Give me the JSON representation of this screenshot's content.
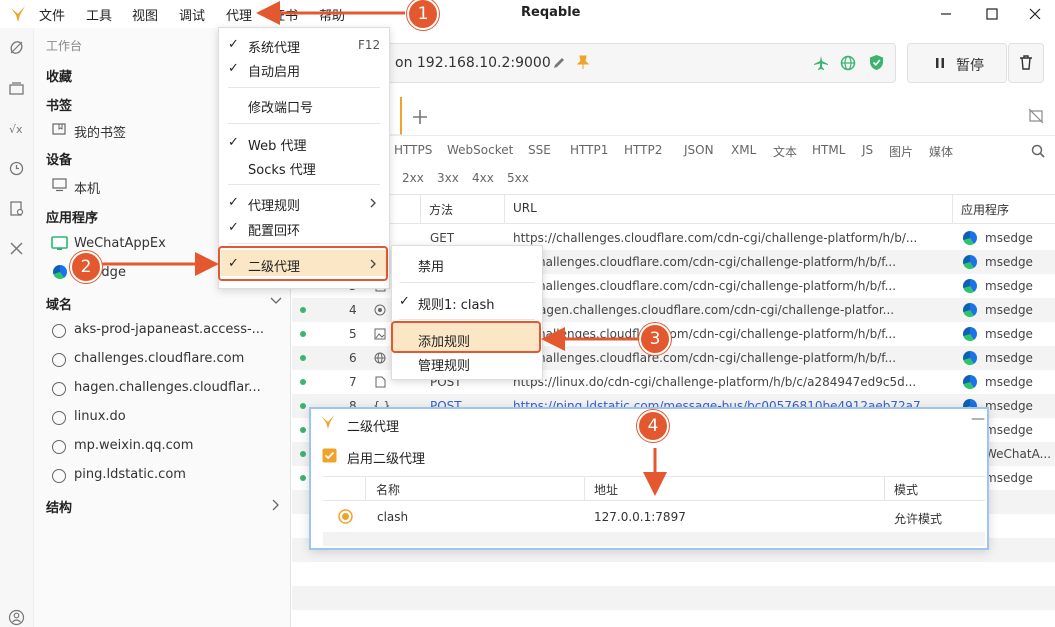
{
  "app": {
    "title": "Reqable"
  },
  "menubar": [
    "文件",
    "工具",
    "视图",
    "调试",
    "代理",
    "证书",
    "帮助"
  ],
  "sidebar": {
    "workspace": "工作台",
    "favorites": "收藏",
    "bookmarks": "书签",
    "my_bookmarks": "我的书签",
    "devices": "设备",
    "this_machine": "本机",
    "apps": "应用程序",
    "app_items": [
      "WeChatAppEx",
      "msedge"
    ],
    "domains": "域名",
    "domain_items": [
      "aks-prod-japaneast.access-...",
      "challenges.cloudflare.com",
      "hagen.challenges.cloudflar...",
      "linux.do",
      "mp.weixin.qq.com",
      "ping.ldstatic.com"
    ],
    "structure": "结构"
  },
  "toolbar": {
    "address": "on 192.168.10.2:9000",
    "pause_label": "暂停"
  },
  "filters": {
    "protocols": [
      "HTTPS",
      "WebSocket",
      "SSE",
      "HTTP1",
      "HTTP2",
      "JSON",
      "XML",
      "文本",
      "HTML",
      "JS",
      "图片",
      "媒体"
    ],
    "status": [
      "2xx",
      "3xx",
      "4xx",
      "5xx"
    ]
  },
  "table": {
    "headers": {
      "method": "方法",
      "url": "URL",
      "app": "应用程序"
    },
    "rows": [
      {
        "id": "",
        "method": "GET",
        "url": "https://challenges.cloudflare.com/cdn-cgi/challenge-platform/h/b/...",
        "app": "msedge"
      },
      {
        "id": "",
        "method": "",
        "url": "s://challenges.cloudflare.com/cdn-cgi/challenge-platform/h/b/f...",
        "app": "msedge"
      },
      {
        "id": "3",
        "method": "",
        "url": "s://challenges.cloudflare.com/cdn-cgi/challenge-platform/h/b/f...",
        "app": "msedge"
      },
      {
        "id": "4",
        "method": "",
        "url": "s://hagen.challenges.cloudflare.com/cdn-cgi/challenge-platfor...",
        "app": "msedge"
      },
      {
        "id": "5",
        "method": "",
        "url": "s://challenges.cloudflare.com/cdn-cgi/challenge-platform/h/b/f...",
        "app": "msedge"
      },
      {
        "id": "6",
        "method": "",
        "url": "s://challenges.cloudflare.com/cdn-cgi/challenge-platform/h/b/f...",
        "app": "msedge"
      },
      {
        "id": "7",
        "method": "POST",
        "url": "https://linux.do/cdn-cgi/challenge-platform/h/b/c/a284947ed9c5d...",
        "app": "msedge"
      },
      {
        "id": "8",
        "method": "POST",
        "url": "https://ping.ldstatic.com/message-bus/bc00576810be4912aeb72a7...",
        "app": "msedge"
      },
      {
        "id": "",
        "method": "",
        "url": "",
        "app": "msedge"
      },
      {
        "id": "",
        "method": "",
        "url": "",
        "app": "WeChatA..."
      },
      {
        "id": "",
        "method": "",
        "url": "",
        "app": "msedge"
      }
    ]
  },
  "proxy_menu": {
    "system_proxy": "系统代理",
    "system_proxy_shortcut": "F12",
    "auto_enable": "自动启用",
    "change_port": "修改端口号",
    "web_proxy": "Web 代理",
    "socks_proxy": "Socks 代理",
    "proxy_rules": "代理规则",
    "loopback": "配置回环",
    "secondary_proxy": "二级代理"
  },
  "secondary_menu": {
    "disable": "禁用",
    "rule1": "规则1: clash",
    "add_rule": "添加规则",
    "manage_rules": "管理规则"
  },
  "dialog": {
    "title": "二级代理",
    "enable_label": "启用二级代理",
    "columns": {
      "name": "名称",
      "address": "地址",
      "mode": "模式"
    },
    "rows": [
      {
        "name": "clash",
        "address": "127.0.0.1:7897",
        "mode": "允许模式"
      }
    ]
  },
  "annotations": [
    "1",
    "2",
    "3",
    "4"
  ],
  "colors": {
    "accent": "#e4582f",
    "brand": "#f0a32a",
    "ok": "#3cb371"
  }
}
